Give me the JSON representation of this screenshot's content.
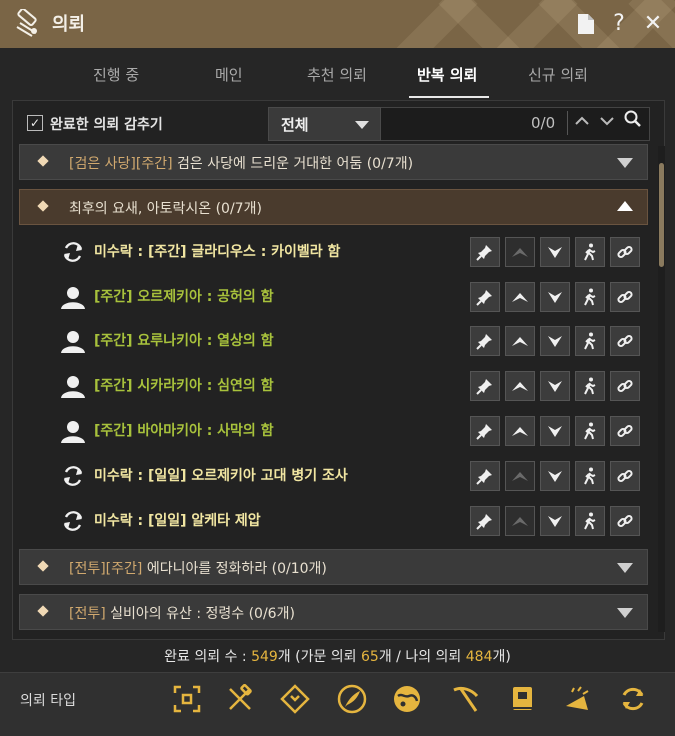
{
  "window": {
    "title": "의뢰"
  },
  "tabs": [
    {
      "label": "진행 중"
    },
    {
      "label": "메인"
    },
    {
      "label": "추천 의뢰"
    },
    {
      "label": "반복 의뢰",
      "active": true
    },
    {
      "label": "신규 의뢰"
    }
  ],
  "filter": {
    "hide_completed_label": "완료한 의뢰 감추기",
    "hide_completed_checked": true,
    "dropdown_value": "전체",
    "count": "0/0"
  },
  "groups": [
    {
      "tag": "[검은 사당][주간]",
      "title": " 검은 사당에 드리운 거대한 어둠 (0/7개)",
      "expanded": false
    },
    {
      "tag": "",
      "title": "최후의 요새, 아토락시온 (0/7개)",
      "expanded": true
    },
    {
      "tag": "[전투][주간]",
      "title": " 에다니아를 정화하라 (0/10개)",
      "expanded": false
    },
    {
      "tag": "[전투]",
      "title": " 실비아의 유산 : 정령수 (0/6개)",
      "expanded": false
    }
  ],
  "quests": [
    {
      "icon": "refresh-icon",
      "text": "미수락 : [주간] 글라디우스 : 카이벨라 함",
      "color": "yellow",
      "track_enabled": false
    },
    {
      "icon": "person-icon",
      "text": "[주간] 오르제키아 : 공허의 함",
      "color": "green",
      "track_enabled": true
    },
    {
      "icon": "person-icon",
      "text": "[주간] 요루나키아 : 열상의 함",
      "color": "green",
      "track_enabled": true
    },
    {
      "icon": "person-icon",
      "text": "[주간] 시카라키아 : 심연의 함",
      "color": "green",
      "track_enabled": true
    },
    {
      "icon": "person-icon",
      "text": "[주간] 바아마키아 : 사막의 함",
      "color": "green",
      "track_enabled": true
    },
    {
      "icon": "refresh-icon",
      "text": "미수락 : [일일] 오르제키아 고대 병기 조사",
      "color": "yellow",
      "track_enabled": false
    },
    {
      "icon": "refresh-icon",
      "text": "미수락 : [일일] 알케타 제압",
      "color": "yellow",
      "track_enabled": false
    }
  ],
  "summary": {
    "prefix": "완료 의뢰 수 : ",
    "total": "549",
    "mid1": "개 (가문 의뢰 ",
    "family": "65",
    "mid2": "개 / 나의 의뢰 ",
    "mine": "484",
    "suffix": "개)"
  },
  "footer": {
    "label": "의뢰 타입",
    "type_icons": [
      "target-icon",
      "scroll-icon",
      "diamond-arrow-icon",
      "quill-icon",
      "globe-icon",
      "pickaxe-icon",
      "book-icon",
      "trumpet-icon",
      "cycle-icon"
    ]
  },
  "colors": {
    "accent": "#e5b53f",
    "quest_yellow": "#f1e6a2",
    "quest_green": "#a8c23c",
    "titlebar": "#7a6546"
  }
}
